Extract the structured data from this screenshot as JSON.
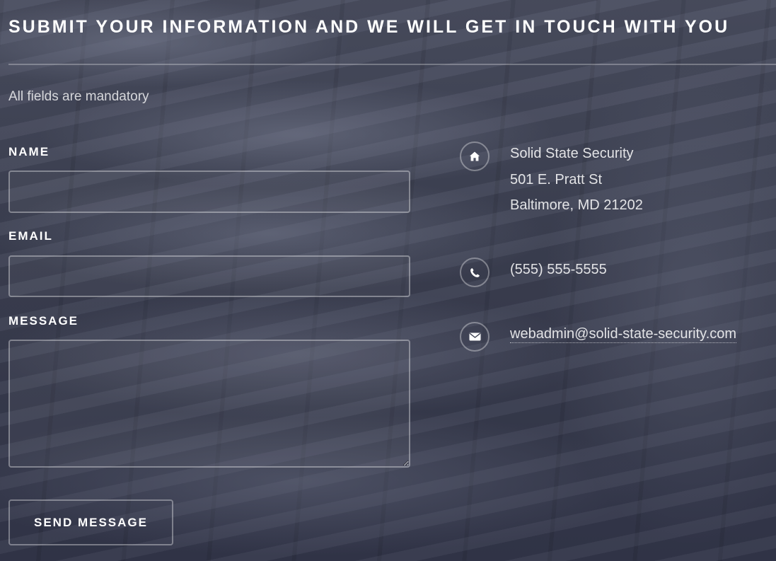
{
  "form": {
    "heading": "SUBMIT YOUR INFORMATION AND WE WILL GET IN TOUCH WITH YOU",
    "note": "All fields are mandatory",
    "name_label": "NAME",
    "name_value": "",
    "email_label": "EMAIL",
    "email_value": "",
    "message_label": "MESSAGE",
    "message_value": "",
    "submit_label": "SEND MESSAGE"
  },
  "contact": {
    "address": {
      "icon": "home-icon",
      "lines": [
        "Solid State Security",
        "501 E. Pratt St",
        "Baltimore, MD 21202"
      ]
    },
    "phone": {
      "icon": "phone-icon",
      "value": "(555) 555-5555"
    },
    "email": {
      "icon": "envelope-icon",
      "value": "webadmin@solid-state-security.com"
    }
  }
}
